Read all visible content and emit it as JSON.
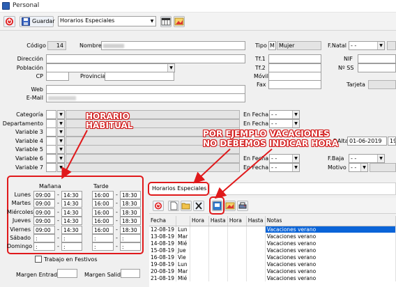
{
  "window": {
    "title": "Personal"
  },
  "toolbar": {
    "save_label": "Guardar",
    "selector_value": "Horarios Especiales"
  },
  "form": {
    "codigo_label": "Código",
    "codigo_value": "14",
    "nombre_label": "Nombre",
    "tipo_label": "Tipo",
    "tipo_code": "M",
    "tipo_value": "Mujer",
    "fnatal_label": "F.Natal",
    "fnatal_value": "- -",
    "direccion_label": "Dirección",
    "poblacion_label": "Población",
    "cp_label": "CP",
    "provincia_label": "Provincia",
    "tf1_label": "Tf.1",
    "tf2_label": "Tf.2",
    "movil_label": "Móvil",
    "fax_label": "Fax",
    "nif_label": "NIF",
    "nss_label": "Nº SS",
    "tarjeta_label": "Tarjeta",
    "web_label": "Web",
    "email_label": "E-Mail",
    "categoria_label": "Categoría",
    "departamento_label": "Departamento",
    "variable3_label": "Variable 3",
    "variable4_label": "Variable 4",
    "variable5_label": "Variable 5",
    "variable6_label": "Variable 6",
    "variable7_label": "Variable 7",
    "en_fecha_label": "En Fecha",
    "empty_date": "- -",
    "falta_label": "F.Alta",
    "falta_value": "01-06-2019",
    "fbaja_label": "F.Baja",
    "fbaja_value": "- -",
    "motivo_label": "Motivo",
    "motivo_value": "- -"
  },
  "schedule": {
    "manana_label": "Mañana",
    "tarde_label": "Tarde",
    "days": [
      {
        "name": "Lunes",
        "m1": "09:00",
        "m2": "14:30",
        "t1": "16:00",
        "t2": "18:30"
      },
      {
        "name": "Martes",
        "m1": "09:00",
        "m2": "14:30",
        "t1": "16:00",
        "t2": "18:30"
      },
      {
        "name": "Miércoles",
        "m1": "09:00",
        "m2": "14:30",
        "t1": "16:00",
        "t2": "18:30"
      },
      {
        "name": "Jueves",
        "m1": "09:00",
        "m2": "14:30",
        "t1": "16:00",
        "t2": "18:30"
      },
      {
        "name": "Viernes",
        "m1": "09:00",
        "m2": "14:30",
        "t1": "16:00",
        "t2": "18:30"
      },
      {
        "name": "Sábado",
        "m1": ":",
        "m2": ":",
        "t1": ":",
        "t2": ":"
      },
      {
        "name": "Domingo",
        "m1": ":",
        "m2": ":",
        "t1": ":",
        "t2": ":"
      }
    ],
    "dash": "-",
    "trabajo_festivos_label": "Trabajo en Festivos",
    "margen_entrada_label": "Margen Entrada",
    "margen_salida_label": "Margen Salida"
  },
  "special": {
    "header_title": "Horarios Especiales",
    "columns": [
      "Fecha",
      "",
      "Hora",
      "Hasta",
      "Hora",
      "Hasta",
      "Notas"
    ],
    "rows": [
      {
        "fecha": "12-08-19",
        "dia": "Lun",
        "notas": "Vacaciones verano"
      },
      {
        "fecha": "13-08-19",
        "dia": "Mar",
        "notas": "Vacaciones verano"
      },
      {
        "fecha": "14-08-19",
        "dia": "Mié",
        "notas": "Vacaciones verano"
      },
      {
        "fecha": "15-08-19",
        "dia": "Jue",
        "notas": "Vacaciones verano"
      },
      {
        "fecha": "16-08-19",
        "dia": "Vie",
        "notas": "Vacaciones verano"
      },
      {
        "fecha": "19-08-19",
        "dia": "Lun",
        "notas": "Vacaciones verano"
      },
      {
        "fecha": "20-08-19",
        "dia": "Mar",
        "notas": "Vacaciones verano"
      },
      {
        "fecha": "21-08-19",
        "dia": "Mié",
        "notas": "Vacaciones verano"
      }
    ]
  },
  "annotations": {
    "habitual_line1": "HORARIO",
    "habitual_line2": "HABITUAL",
    "vacaciones_line1": "POR EJEMPLO  VACACIONES",
    "vacaciones_line2": "NO DEBEMOS INDICAR HORA",
    "color": "#e0191b"
  },
  "colors": {
    "selection": "#0a64d8",
    "panel": "#f0f0f0"
  }
}
